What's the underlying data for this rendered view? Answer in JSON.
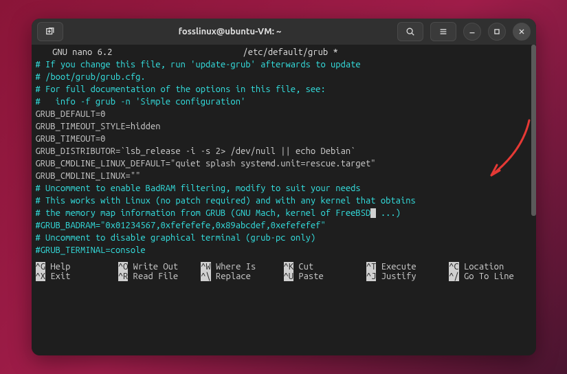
{
  "window": {
    "title": "fosslinux@ubuntu-VM: ~"
  },
  "nano": {
    "appname": "  GNU nano 6.2",
    "filepath": "/etc/default/grub *"
  },
  "lines": [
    {
      "cls": "comment",
      "t": "# If you change this file, run 'update-grub' afterwards to update"
    },
    {
      "cls": "comment",
      "t": "# /boot/grub/grub.cfg."
    },
    {
      "cls": "comment",
      "t": "# For full documentation of the options in this file, see:"
    },
    {
      "cls": "comment",
      "t": "#   info -f grub -n 'Simple configuration'"
    },
    {
      "cls": "plain",
      "t": ""
    },
    {
      "cls": "plain",
      "t": "GRUB_DEFAULT=0"
    },
    {
      "cls": "plain",
      "t": "GRUB_TIMEOUT_STYLE=hidden"
    },
    {
      "cls": "plain",
      "t": "GRUB_TIMEOUT=0"
    },
    {
      "cls": "plain",
      "t": "GRUB_DISTRIBUTOR=`lsb_release -i -s 2> /dev/null || echo Debian`"
    },
    {
      "cls": "plain",
      "t": "GRUB_CMDLINE_LINUX_DEFAULT=\"quiet splash systemd.unit=rescue.target\""
    },
    {
      "cls": "plain",
      "t": "GRUB_CMDLINE_LINUX=\"\""
    },
    {
      "cls": "plain",
      "t": ""
    },
    {
      "cls": "comment",
      "t": "# Uncomment to enable BadRAM filtering, modify to suit your needs"
    },
    {
      "cls": "comment",
      "t": "# This works with Linux (no patch required) and with any kernel that obtains"
    },
    {
      "cls": "comment",
      "t": "# the memory map information from GRUB (GNU Mach, kernel of FreeBSD",
      "cursor_after": " ...)"
    },
    {
      "cls": "comment",
      "t": "#GRUB_BADRAM=\"0x01234567,0xfefefefe,0x89abcdef,0xefefefef\""
    },
    {
      "cls": "plain",
      "t": ""
    },
    {
      "cls": "comment",
      "t": "# Uncomment to disable graphical terminal (grub-pc only)"
    },
    {
      "cls": "comment",
      "t": "#GRUB_TERMINAL=console"
    }
  ],
  "shortcuts": [
    {
      "key": "^G",
      "label": "Help"
    },
    {
      "key": "^O",
      "label": "Write Out"
    },
    {
      "key": "^W",
      "label": "Where Is"
    },
    {
      "key": "^K",
      "label": "Cut"
    },
    {
      "key": "^T",
      "label": "Execute"
    },
    {
      "key": "^C",
      "label": "Location"
    },
    {
      "key": "^X",
      "label": "Exit"
    },
    {
      "key": "^R",
      "label": "Read File"
    },
    {
      "key": "^\\",
      "label": "Replace"
    },
    {
      "key": "^U",
      "label": "Paste"
    },
    {
      "key": "^J",
      "label": "Justify"
    },
    {
      "key": "^/",
      "label": "Go To Line"
    }
  ]
}
